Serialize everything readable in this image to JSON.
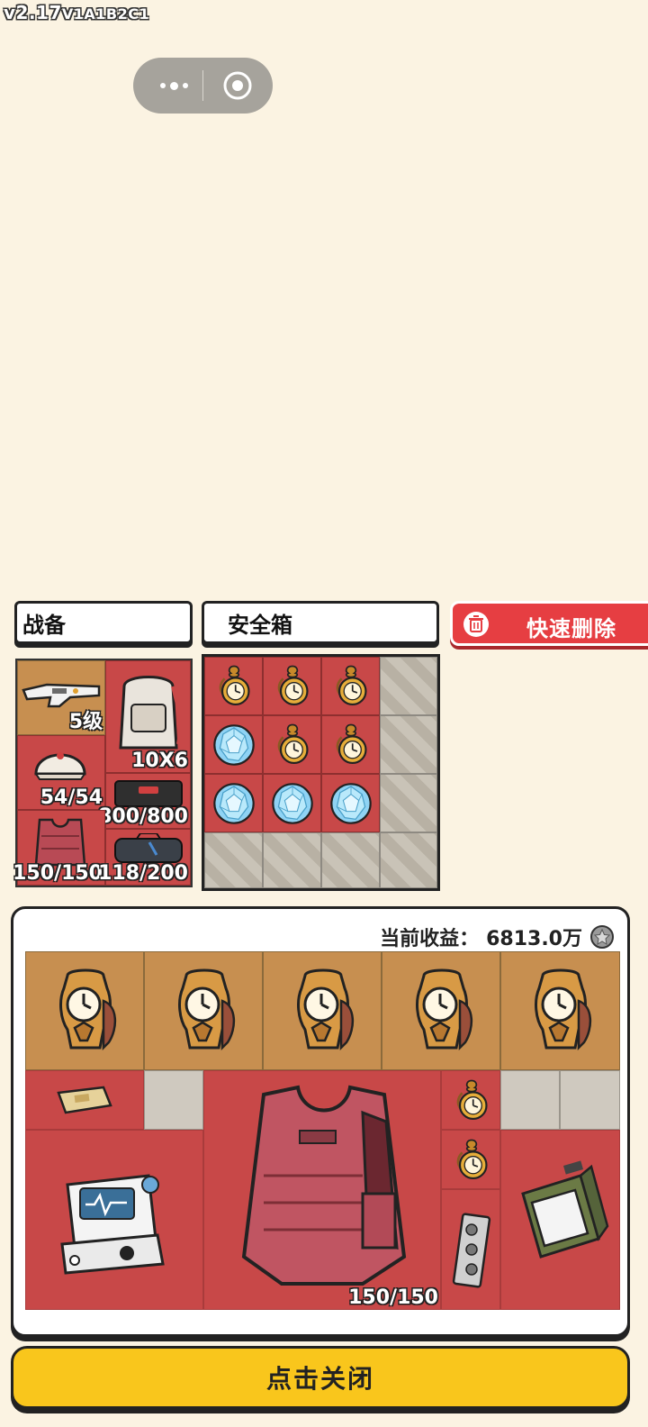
{
  "version": {
    "main": "v2.17",
    "sub": "V1A1B2C1"
  },
  "tabs": {
    "gear": "战备",
    "safe": "安全箱"
  },
  "quick_delete": "快速删除",
  "gear_stats": {
    "weapon": "5级",
    "backpack": "10X6",
    "helmet": "54/54",
    "case": "800/800",
    "vest": "150/150",
    "bag": "118/200"
  },
  "earnings": {
    "label": "当前收益：",
    "value": "6813.0万"
  },
  "loot_vest_stat": "150/150",
  "close_button": "点击关闭",
  "colors": {
    "background": "#fbf3e2",
    "slot_red": "#c84848",
    "slot_tan": "#c78f50",
    "button_yellow": "#f9c61c",
    "delete_red": "#e63e42"
  }
}
